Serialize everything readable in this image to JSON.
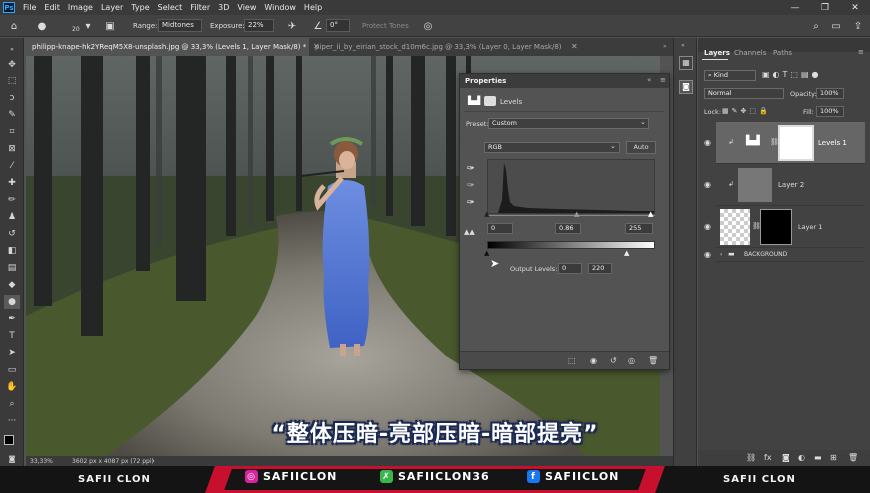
{
  "menubar": {
    "items": [
      "File",
      "Edit",
      "Image",
      "Layer",
      "Type",
      "Select",
      "Filter",
      "3D",
      "View",
      "Window",
      "Help"
    ],
    "window_controls": [
      "—",
      "❐",
      "✕"
    ]
  },
  "options": {
    "brush_size": "20",
    "range_label": "Range:",
    "range_value": "Midtones",
    "exposure_label": "Exposure:",
    "exposure_value": "22%",
    "angle_value": "0°",
    "protect_tones": "Protect Tones"
  },
  "tabs": [
    {
      "label": "philipp-knape-hk2YReqM5X8-unsplash.jpg @ 33,3% (Levels 1, Layer Mask/8) *"
    },
    {
      "label": "piper_ii_by_eirian_stock_d10m6c.jpg @ 33,3% (Layer 0, Layer Mask/8) *"
    }
  ],
  "properties": {
    "title": "Properties",
    "subtitle": "Levels",
    "preset_label": "Preset:",
    "preset_value": "Custom",
    "channel": "RGB",
    "auto_label": "Auto",
    "input_black": "0",
    "input_gamma": "0.86",
    "input_white": "255",
    "output_label": "Output Levels:",
    "output_black": "0",
    "output_white": "220"
  },
  "panels": {
    "tabs": [
      "Layers",
      "Channels",
      "Paths"
    ],
    "kind_label": "Kind",
    "blend_mode": "Normal",
    "opacity_label": "Opacity:",
    "opacity_value": "100%",
    "lock_label": "Lock:",
    "fill_label": "Fill:",
    "fill_value": "100%",
    "layers": [
      "Levels 1",
      "Layer 2",
      "Layer 1",
      "BACKGROUND"
    ]
  },
  "status": {
    "zoom": "33,33%",
    "doc_size": "3602 px x 4087 px (72 ppi)"
  },
  "caption": "“整体压暗-亮部压暗-暗部提亮”",
  "banner": {
    "left_name": "SAFII CLON",
    "right_name": "SAFII CLON",
    "instagram": "SAFIICLON",
    "social2": "SAFIICLON36",
    "facebook": "SAFIICLON"
  },
  "colors": {
    "accent_red": "#c8102e",
    "instagram": "#d6249f",
    "social_green": "#39b54a",
    "facebook": "#1877f2"
  }
}
